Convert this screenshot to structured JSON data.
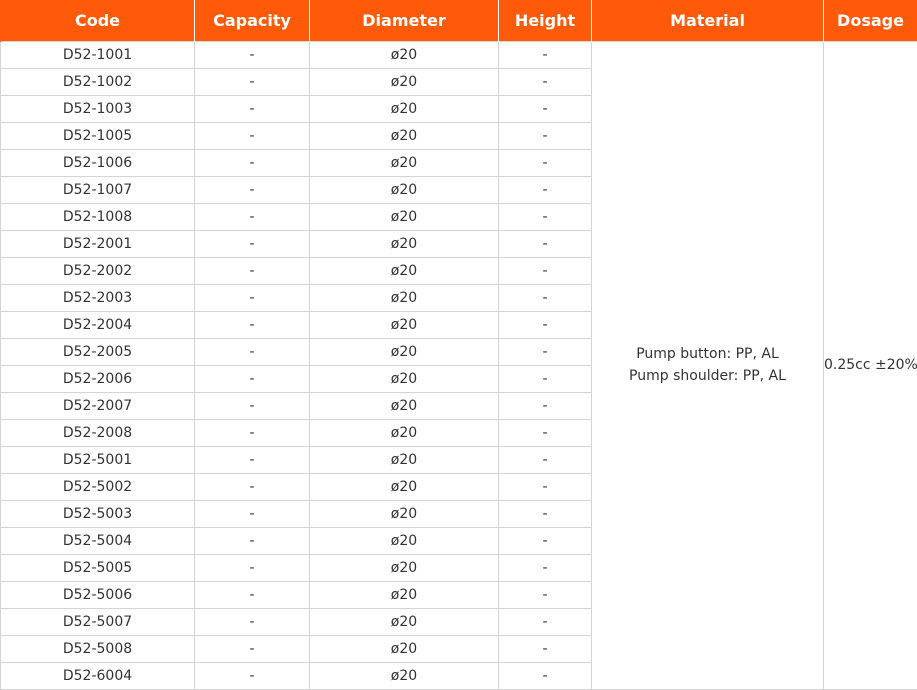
{
  "headers": {
    "code": "Code",
    "capacity": "Capacity",
    "diameter": "Diameter",
    "height": "Height",
    "material": "Material",
    "dosage": "Dosage"
  },
  "rows": [
    {
      "code": "D52-1001",
      "capacity": "-",
      "diameter": "ø20",
      "height": "-"
    },
    {
      "code": "D52-1002",
      "capacity": "-",
      "diameter": "ø20",
      "height": "-"
    },
    {
      "code": "D52-1003",
      "capacity": "-",
      "diameter": "ø20",
      "height": "-"
    },
    {
      "code": "D52-1005",
      "capacity": "-",
      "diameter": "ø20",
      "height": "-"
    },
    {
      "code": "D52-1006",
      "capacity": "-",
      "diameter": "ø20",
      "height": "-"
    },
    {
      "code": "D52-1007",
      "capacity": "-",
      "diameter": "ø20",
      "height": "-"
    },
    {
      "code": "D52-1008",
      "capacity": "-",
      "diameter": "ø20",
      "height": "-"
    },
    {
      "code": "D52-2001",
      "capacity": "-",
      "diameter": "ø20",
      "height": "-"
    },
    {
      "code": "D52-2002",
      "capacity": "-",
      "diameter": "ø20",
      "height": "-"
    },
    {
      "code": "D52-2003",
      "capacity": "-",
      "diameter": "ø20",
      "height": "-"
    },
    {
      "code": "D52-2004",
      "capacity": "-",
      "diameter": "ø20",
      "height": "-"
    },
    {
      "code": "D52-2005",
      "capacity": "-",
      "diameter": "ø20",
      "height": "-"
    },
    {
      "code": "D52-2006",
      "capacity": "-",
      "diameter": "ø20",
      "height": "-"
    },
    {
      "code": "D52-2007",
      "capacity": "-",
      "diameter": "ø20",
      "height": "-"
    },
    {
      "code": "D52-2008",
      "capacity": "-",
      "diameter": "ø20",
      "height": "-"
    },
    {
      "code": "D52-5001",
      "capacity": "-",
      "diameter": "ø20",
      "height": "-"
    },
    {
      "code": "D52-5002",
      "capacity": "-",
      "diameter": "ø20",
      "height": "-"
    },
    {
      "code": "D52-5003",
      "capacity": "-",
      "diameter": "ø20",
      "height": "-"
    },
    {
      "code": "D52-5004",
      "capacity": "-",
      "diameter": "ø20",
      "height": "-"
    },
    {
      "code": "D52-5005",
      "capacity": "-",
      "diameter": "ø20",
      "height": "-"
    },
    {
      "code": "D52-5006",
      "capacity": "-",
      "diameter": "ø20",
      "height": "-"
    },
    {
      "code": "D52-5007",
      "capacity": "-",
      "diameter": "ø20",
      "height": "-"
    },
    {
      "code": "D52-5008",
      "capacity": "-",
      "diameter": "ø20",
      "height": "-"
    },
    {
      "code": "D52-6004",
      "capacity": "-",
      "diameter": "ø20",
      "height": "-"
    }
  ],
  "material_lines": [
    "Pump button: PP, AL",
    "Pump shoulder: PP, AL"
  ],
  "dosage": "0.25cc ±20%",
  "colors": {
    "header_bg": "#ff5a0a",
    "header_text": "#ffffff",
    "border": "#d4d4d4",
    "cell_text": "#333333"
  }
}
